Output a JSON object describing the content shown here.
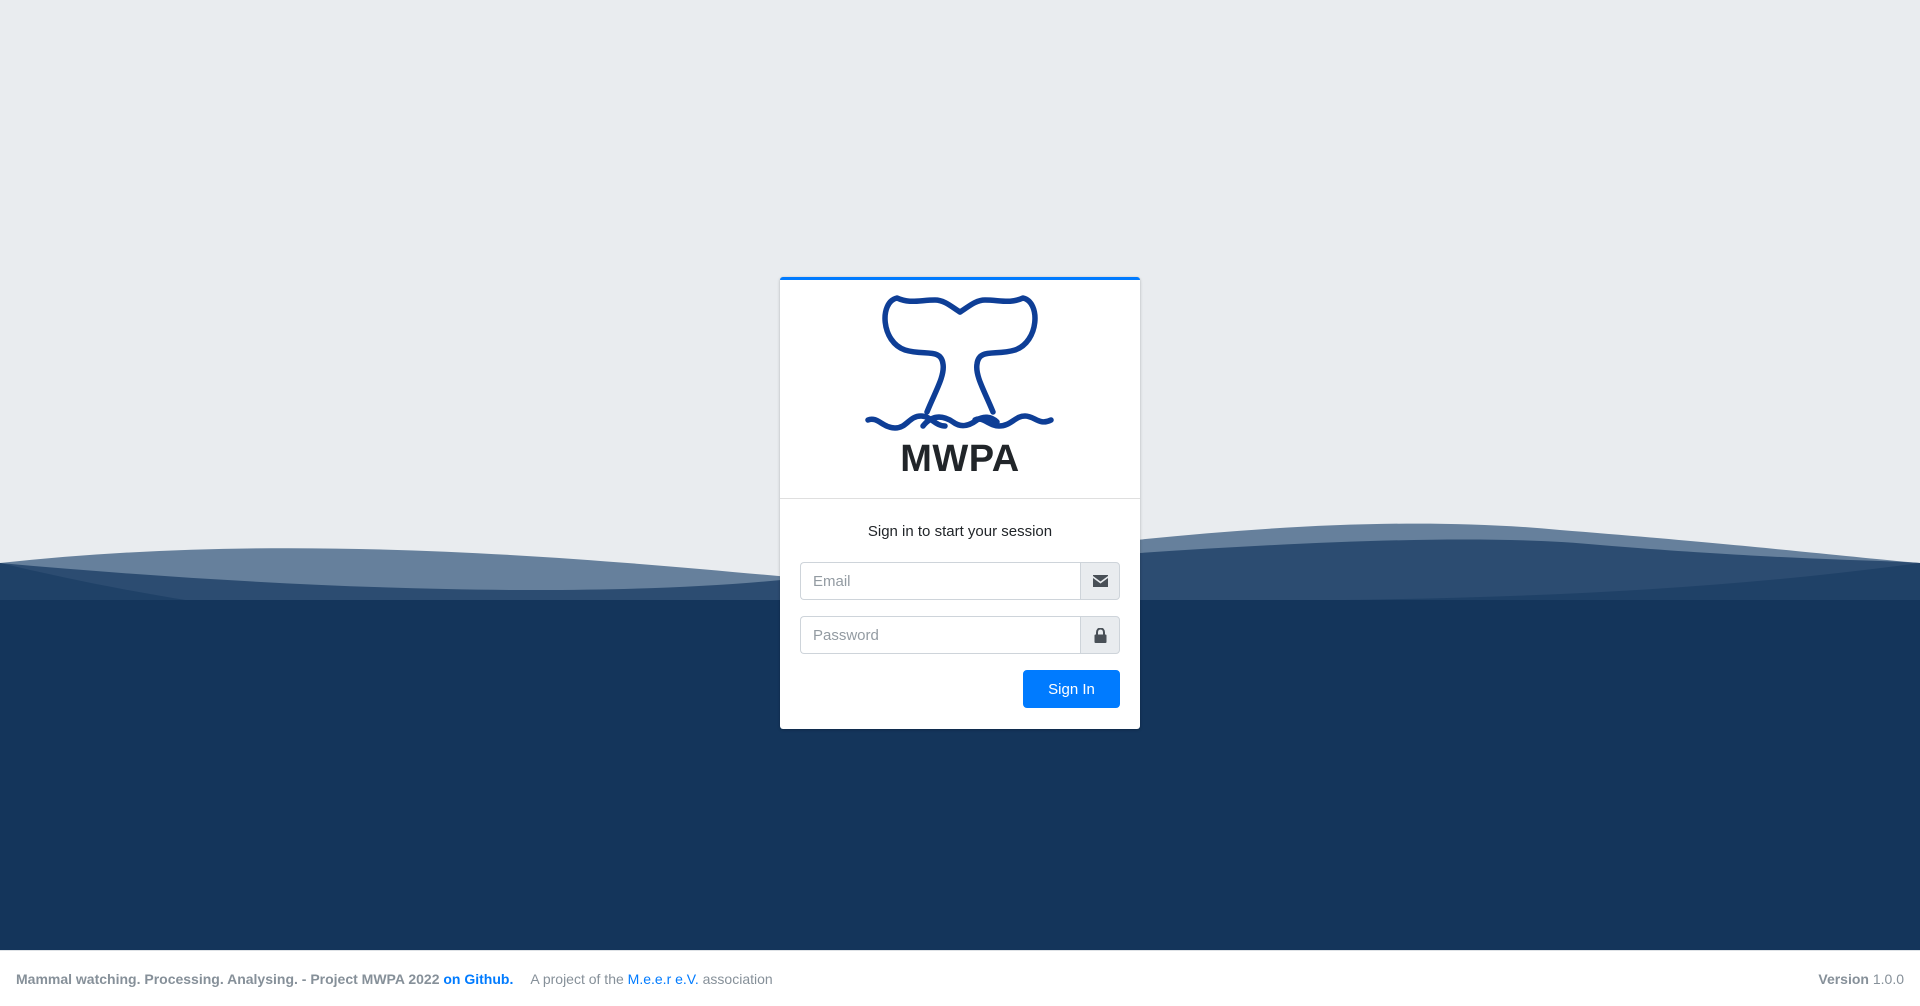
{
  "app": {
    "title": "MWPA",
    "logo_icon": "whale-tail-icon"
  },
  "login": {
    "message": "Sign in to start your session",
    "email_placeholder": "Email",
    "email_value": "",
    "email_icon": "envelope-icon",
    "password_placeholder": "Password",
    "password_value": "",
    "password_icon": "lock-icon",
    "submit_label": "Sign In"
  },
  "footer": {
    "tagline": "Mammal watching. Processing. Analysing. - Project MWPA 2022",
    "github_link": "on Github",
    "period": ".",
    "project_prefix": "A project of the",
    "association_link": "M.e.e.r e.V.",
    "project_suffix": "association",
    "version_label": "Version",
    "version_value": "1.0.0"
  },
  "colors": {
    "accent": "#007bff",
    "sea_dark": "#14355b",
    "sky": "#e9ecef",
    "logo": "#0e3e96"
  }
}
